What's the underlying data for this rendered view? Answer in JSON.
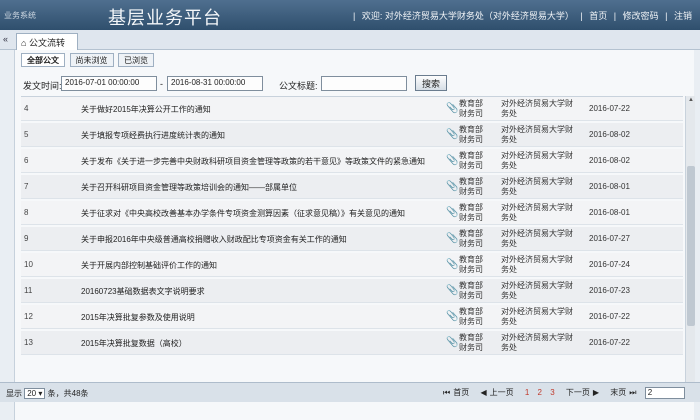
{
  "header": {
    "system_label": "业务系统",
    "app_title": "基层业务平台",
    "welcome": "欢迎: 对外经济贸易大学财务处（对外经济贸易大学）",
    "home": "首页",
    "change_password": "修改密码",
    "logout": "注销"
  },
  "main_tab": {
    "collapse_icon": "«",
    "label": "公文流转"
  },
  "sub_tabs": [
    "全部公文",
    "尚未浏览",
    "已浏览"
  ],
  "filter": {
    "date_label": "发文时间:",
    "date_from": "2016-07-01 00:00:00",
    "date_sep": "-",
    "date_to": "2016-08-31 00:00:00",
    "title_label": "公文标题:",
    "title_value": "",
    "search_button": "搜索"
  },
  "rows": [
    {
      "num": "4",
      "title": "关于做好2015年决算公开工作的通知",
      "from": "教育部财务司",
      "org": "对外经济贸易大学财务处",
      "date": "2016-07-22"
    },
    {
      "num": "5",
      "title": "关于填报专项经费执行进度统计表的通知",
      "from": "教育部财务司",
      "org": "对外经济贸易大学财务处",
      "date": "2016-08-02"
    },
    {
      "num": "6",
      "title": "关于发布《关于进一步完善中央财政科研项目资金管理等政策的若干意见》等政策文件的紧急通知",
      "from": "教育部财务司",
      "org": "对外经济贸易大学财务处",
      "date": "2016-08-02"
    },
    {
      "num": "7",
      "title": "关于召开科研项目资金管理等政策培训会的通知——部属单位",
      "from": "教育部财务司",
      "org": "对外经济贸易大学财务处",
      "date": "2016-08-01"
    },
    {
      "num": "8",
      "title": "关于征求对《中央高校改善基本办学条件专项资金测算因素（征求意见稿）》有关意见的通知",
      "from": "教育部财务司",
      "org": "对外经济贸易大学财务处",
      "date": "2016-08-01"
    },
    {
      "num": "9",
      "title": "关于申报2016年中央级普通高校捐赠收入财政配比专项资金有关工作的通知",
      "from": "教育部财务司",
      "org": "对外经济贸易大学财务处",
      "date": "2016-07-27"
    },
    {
      "num": "10",
      "title": "关于开展内部控制基础评价工作的通知",
      "from": "教育部财务司",
      "org": "对外经济贸易大学财务处",
      "date": "2016-07-24"
    },
    {
      "num": "11",
      "title": "20160723基础数据表文字说明要求",
      "from": "教育部财务司",
      "org": "对外经济贸易大学财务处",
      "date": "2016-07-23"
    },
    {
      "num": "12",
      "title": "2015年决算批复参数及使用说明",
      "from": "教育部财务司",
      "org": "对外经济贸易大学财务处",
      "date": "2016-07-22"
    },
    {
      "num": "13",
      "title": "2015年决算批复数据（高校）",
      "from": "教育部财务司",
      "org": "对外经济贸易大学财务处",
      "date": "2016-07-22"
    }
  ],
  "pager": {
    "show_label": "显示",
    "page_size": "20",
    "total": "条，共48条",
    "first": "首页",
    "prev": "上一页",
    "pages": [
      "1",
      "2",
      "3"
    ],
    "next": "下一页",
    "last": "末页",
    "goto_value": "2"
  }
}
